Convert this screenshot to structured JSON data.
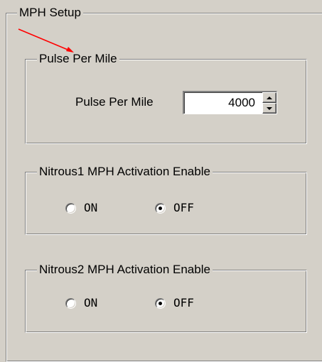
{
  "mph_setup": {
    "title": "MPH Setup",
    "pulse_group": {
      "title": "Pulse Per Mile",
      "field_label": "Pulse Per Mile",
      "value": "4000"
    },
    "nitrous1_group": {
      "title": "Nitrous1 MPH Activation Enable",
      "options": [
        {
          "label": "ON",
          "selected": false
        },
        {
          "label": "OFF",
          "selected": true
        }
      ]
    },
    "nitrous2_group": {
      "title": "Nitrous2 MPH Activation Enable",
      "options": [
        {
          "label": "ON",
          "selected": false
        },
        {
          "label": "OFF",
          "selected": true
        }
      ]
    }
  },
  "annotation": {
    "arrow_color": "#ff0000"
  },
  "icons": {
    "spin_up": "triangle-up",
    "spin_down": "triangle-down"
  }
}
